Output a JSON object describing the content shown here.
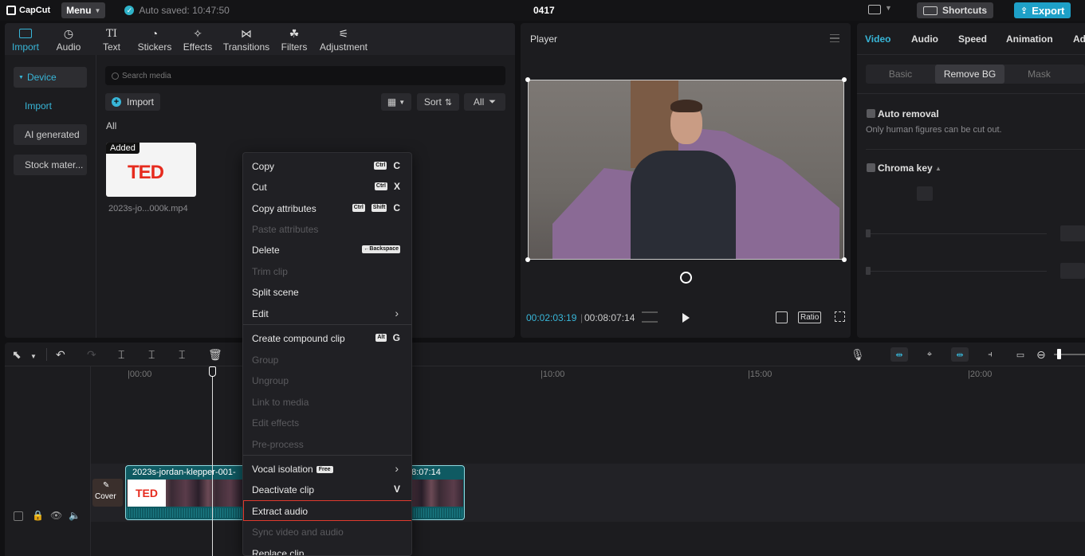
{
  "topbar": {
    "brand": "CapCut",
    "menu_label": "Menu",
    "autosave": "Auto saved: 10:47:50",
    "project_title": "0417",
    "shortcuts_label": "Shortcuts",
    "export_label": "Export"
  },
  "media": {
    "tabs": [
      {
        "label": "Import",
        "icon": "import-icon"
      },
      {
        "label": "Audio",
        "icon": "audio-icon"
      },
      {
        "label": "Text",
        "icon": "text-icon"
      },
      {
        "label": "Stickers",
        "icon": "stickers-icon"
      },
      {
        "label": "Effects",
        "icon": "effects-icon"
      },
      {
        "label": "Transitions",
        "icon": "transitions-icon"
      },
      {
        "label": "Filters",
        "icon": "filters-icon"
      },
      {
        "label": "Adjustment",
        "icon": "adjustment-icon"
      }
    ],
    "sidebar": {
      "device": "Device",
      "import": "Import",
      "ai_generated": "AI generated",
      "stock": "Stock mater..."
    },
    "search_placeholder": "Search media",
    "import_button": "Import",
    "sort_label": "Sort",
    "filter_label": "All",
    "section_label": "All",
    "item": {
      "badge": "Added",
      "thumb_text": "TED",
      "filename": "2023s-jo...000k.mp4"
    }
  },
  "player": {
    "title": "Player",
    "current_time": "00:02:03:19",
    "total_time": "00:08:07:14",
    "ratio_label": "Ratio"
  },
  "props": {
    "tabs": [
      "Video",
      "Audio",
      "Speed",
      "Animation",
      "Ad"
    ],
    "subtabs": [
      "Basic",
      "Remove BG",
      "Mask"
    ],
    "auto_removal": "Auto removal",
    "auto_removal_note": "Only human figures can be cut out.",
    "chroma_key": "Chroma key"
  },
  "timeline": {
    "ruler": [
      "|00:00",
      "|10:00",
      "|15:00",
      "|20:00"
    ],
    "cover_label": "Cover",
    "clip_name": "2023s-jordan-klepper-001-",
    "clip_duration": "08:07:14",
    "clip_thumb_text": "TED"
  },
  "context_menu": {
    "items": [
      {
        "label": "Copy",
        "keys": [
          "Ctrl"
        ],
        "letter": "C",
        "disabled": false
      },
      {
        "label": "Cut",
        "keys": [
          "Ctrl"
        ],
        "letter": "X",
        "disabled": false
      },
      {
        "label": "Copy attributes",
        "keys": [
          "Ctrl",
          "Shift"
        ],
        "letter": "C",
        "disabled": false
      },
      {
        "label": "Paste attributes",
        "disabled": true
      },
      {
        "label": "Delete",
        "keys": [
          "←Backspace"
        ],
        "letter": "",
        "disabled": false
      },
      {
        "label": "Trim clip",
        "disabled": true
      },
      {
        "label": "Split scene",
        "disabled": false
      },
      {
        "label": "Edit",
        "submenu": true,
        "disabled": false
      },
      {
        "label": "Create compound clip",
        "keys": [
          "Alt"
        ],
        "letter": "G",
        "disabled": false
      },
      {
        "label": "Group",
        "disabled": true
      },
      {
        "label": "Ungroup",
        "disabled": true
      },
      {
        "label": "Link to media",
        "disabled": true
      },
      {
        "label": "Edit effects",
        "disabled": true
      },
      {
        "label": "Pre-process",
        "disabled": true
      },
      {
        "label": "Vocal isolation",
        "badge": "Free",
        "submenu": true,
        "disabled": false
      },
      {
        "label": "Deactivate clip",
        "letter": "V",
        "disabled": false
      },
      {
        "label": "Extract audio",
        "disabled": false,
        "highlight": true
      },
      {
        "label": "Sync video and audio",
        "disabled": true
      },
      {
        "label": "Replace clip",
        "disabled": false
      }
    ]
  },
  "colors": {
    "accent": "#38b6d8",
    "export": "#1ea0c8",
    "highlight_outline": "#e03a2e",
    "clip": "#0f5a62"
  }
}
